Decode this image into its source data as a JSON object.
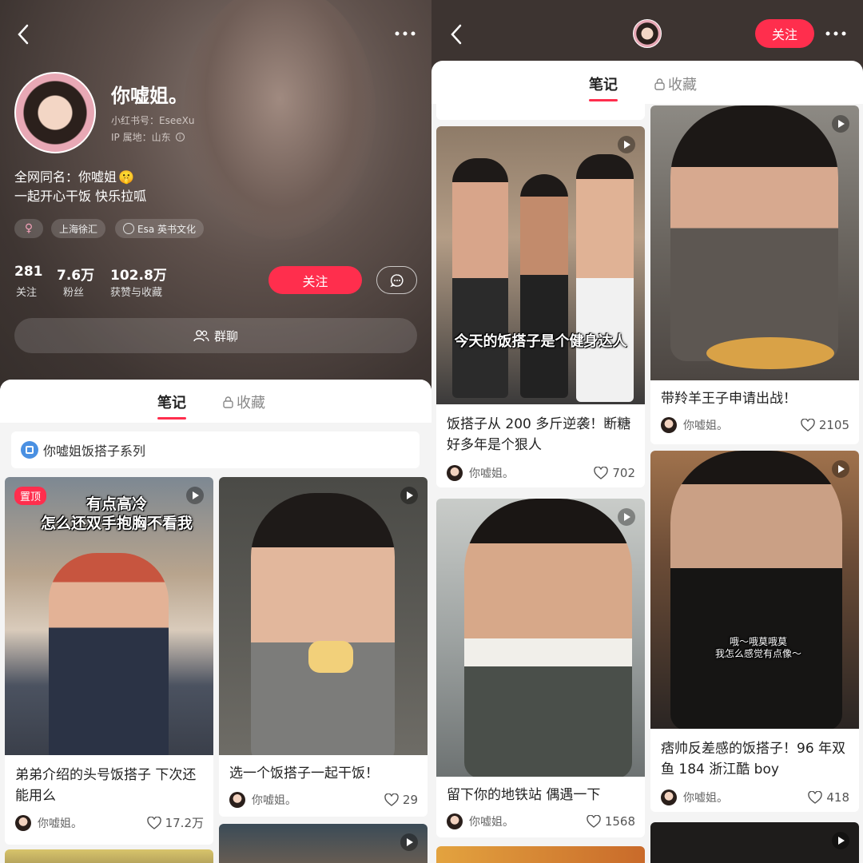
{
  "left": {
    "profile": {
      "name": "你嘘姐。",
      "red_id": "小红书号：EseeXu",
      "ip": "IP 属地：山东",
      "bio_line1": "全网同名：你嘘姐",
      "bio_emoji": "🤫",
      "bio_line2": "一起开心干饭 快乐拉呱",
      "tags": [
        "♀",
        "上海徐汇",
        "Esa 英书文化"
      ],
      "stats": [
        {
          "value": "281",
          "label": "关注"
        },
        {
          "value": "7.6万",
          "label": "粉丝"
        },
        {
          "value": "102.8万",
          "label": "获赞与收藏"
        }
      ],
      "follow_label": "关注",
      "group_chat_label": "群聊"
    },
    "tabs": {
      "notes": "笔记",
      "collections": "收藏"
    },
    "series_label": "你嘘姐饭搭子系列",
    "cards": [
      {
        "title": "弟弟介绍的头号饭搭子 下次还能用么",
        "author": "你嘘姐。",
        "likes": "17.2万",
        "pinned": "置顶",
        "overlay": "有点高冷\n怎么还双手抱胸不看我"
      },
      {
        "title": "选一个饭搭子一起干饭！",
        "author": "你嘘姐。",
        "likes": "29"
      }
    ]
  },
  "right": {
    "follow_label": "关注",
    "tabs": {
      "notes": "笔记",
      "collections": "收藏"
    },
    "cards": [
      {
        "title": "饭搭子从 200 多斤逆袭！断糖好多年是个狠人",
        "author": "你嘘姐。",
        "likes": "702",
        "overlay": "今天的饭搭子是个健身达人"
      },
      {
        "title": "带羚羊王子申请出战！",
        "author": "你嘘姐。",
        "likes": "2105"
      },
      {
        "title": "留下你的地铁站 偶遇一下",
        "author": "你嘘姐。",
        "likes": "1568"
      },
      {
        "title": "痞帅反差感的饭搭子！96 年双鱼 184 浙江酷 boy",
        "author": "你嘘姐。",
        "likes": "418",
        "overlay": "哦～哦莫哦莫\n我怎么感觉有点像～"
      }
    ]
  },
  "icons": [
    "back-icon",
    "more-icon",
    "chat-icon",
    "group-icon",
    "lock-icon",
    "heart-icon",
    "play-icon",
    "series-icon",
    "female-icon",
    "org-icon",
    "info-icon"
  ],
  "colors": {
    "accent": "#ff2e4d",
    "hero_bg": "#3e3532"
  }
}
